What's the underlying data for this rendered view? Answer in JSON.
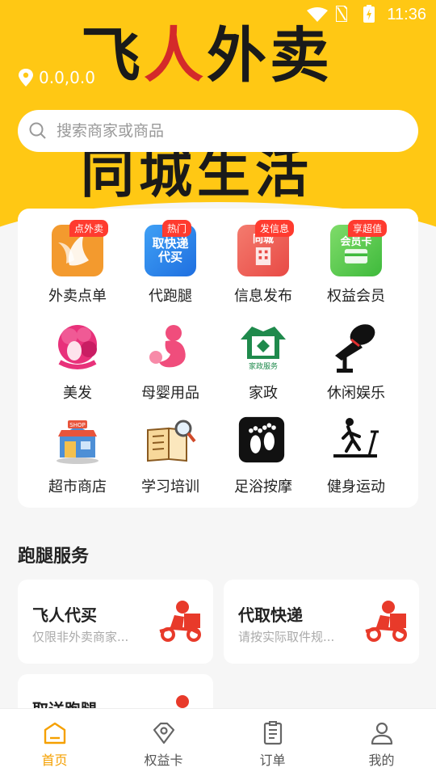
{
  "status": {
    "time": "11:36"
  },
  "banner": {
    "line1": [
      "飞",
      "人",
      "外",
      "卖"
    ],
    "line2": "同城生活"
  },
  "location": {
    "text": "0.0,0.0"
  },
  "search": {
    "placeholder": "搜索商家或商品"
  },
  "categories": [
    {
      "label": "外卖点单",
      "badge": "点外卖",
      "icon": "takeout-icon"
    },
    {
      "label": "代跑腿",
      "badge": "热门",
      "icon": "errand-icon",
      "tile_text": "取快递 代买"
    },
    {
      "label": "信息发布",
      "badge": "发信息",
      "icon": "info-icon",
      "tile_text": "同城"
    },
    {
      "label": "权益会员",
      "badge": "享超值",
      "icon": "member-card-icon",
      "tile_text": "会员卡"
    },
    {
      "label": "美发",
      "icon": "hair-icon"
    },
    {
      "label": "母婴用品",
      "icon": "maternity-icon"
    },
    {
      "label": "家政",
      "icon": "housekeeping-icon",
      "tile_text": "家政服务"
    },
    {
      "label": "休闲娱乐",
      "icon": "microphone-icon"
    },
    {
      "label": "超市商店",
      "icon": "shop-icon",
      "tile_text": "SHOP"
    },
    {
      "label": "学习培训",
      "icon": "book-icon"
    },
    {
      "label": "足浴按摩",
      "icon": "footprint-icon"
    },
    {
      "label": "健身运动",
      "icon": "treadmill-icon"
    }
  ],
  "section": {
    "title": "跑腿服务"
  },
  "services": [
    {
      "title": "飞人代买",
      "subtitle": "仅限非外卖商家..."
    },
    {
      "title": "代取快递",
      "subtitle": "请按实际取件规..."
    },
    {
      "title": "取送跑腿",
      "subtitle": ""
    }
  ],
  "tabs": [
    {
      "label": "首页",
      "icon": "home-icon",
      "active": true
    },
    {
      "label": "权益卡",
      "icon": "tag-icon",
      "active": false
    },
    {
      "label": "订单",
      "icon": "order-icon",
      "active": false
    },
    {
      "label": "我的",
      "icon": "user-icon",
      "active": false
    }
  ],
  "colors": {
    "accent": "#ffc814",
    "active_tab": "#f5a000",
    "badge": "#ff3b2f"
  }
}
